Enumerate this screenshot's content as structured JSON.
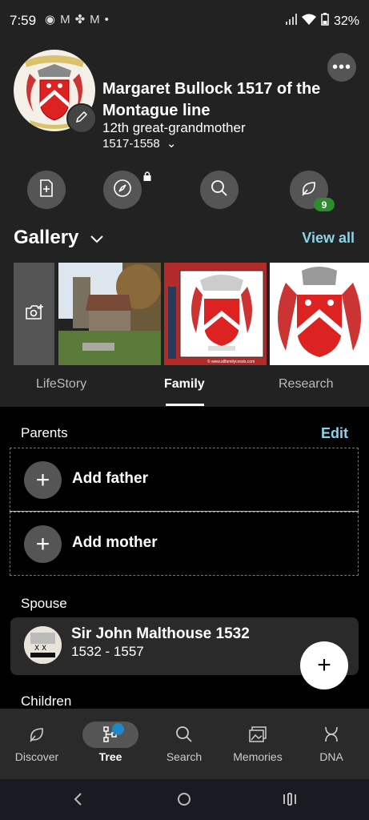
{
  "status": {
    "time": "7:59",
    "notif_icons": [
      "app-icon",
      "gmail-icon",
      "pinwheel-icon",
      "gmail-icon",
      "dot-icon"
    ],
    "battery": "32%"
  },
  "person": {
    "name": "Margaret Bullock 1517 of the Montague line",
    "relation": "12th great-grandmother",
    "dates": "1517-1558"
  },
  "actions": {
    "hints_badge": "9"
  },
  "gallery": {
    "title": "Gallery",
    "view_all": "View all",
    "watermark": "© www.allfamilycrests.com"
  },
  "tabs": [
    "LifeStory",
    "Family",
    "Research"
  ],
  "active_tab": "Family",
  "family": {
    "parents_label": "Parents",
    "edit": "Edit",
    "add_father": "Add father",
    "add_mother": "Add mother",
    "spouse_label": "Spouse",
    "spouse": {
      "name": "Sir John Malthouse 1532",
      "dates": "1532 - 1557"
    },
    "children_label": "Children"
  },
  "nav": [
    "Discover",
    "Tree",
    "Search",
    "Memories",
    "DNA"
  ],
  "active_nav": "Tree",
  "colors": {
    "accent": "#8ad4ec",
    "background": "#000000",
    "header": "#222222",
    "hint_badge": "#2e8b2e",
    "tree_dot": "#1e88c8"
  }
}
